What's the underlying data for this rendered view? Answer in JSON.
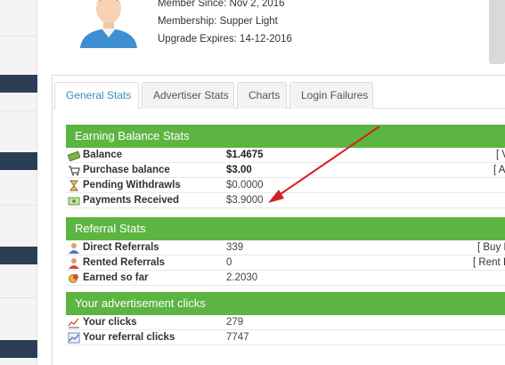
{
  "profile": {
    "member_since": "Member Since: Nov 2, 2016",
    "membership": "Membership: Supper Light",
    "upgrade_expires": "Upgrade Expires: 14-12-2016"
  },
  "tabs": [
    {
      "label": "General Stats"
    },
    {
      "label": "Advertiser Stats"
    },
    {
      "label": "Charts"
    },
    {
      "label": "Login Failures"
    }
  ],
  "earning": {
    "title": "Earning Balance Stats",
    "rows": [
      {
        "label": "Balance",
        "value": "$1.4675",
        "action": "[ V"
      },
      {
        "label": "Purchase balance",
        "value": "$3.00",
        "action": "[ A"
      },
      {
        "label": "Pending Withdrawls",
        "value": "$0.0000",
        "action": ""
      },
      {
        "label": "Payments Received",
        "value": "$3.9000",
        "action": ""
      }
    ]
  },
  "referral": {
    "title": "Referral Stats",
    "rows": [
      {
        "label": "Direct Referrals",
        "value": "339",
        "action": "[ Buy I"
      },
      {
        "label": "Rented Referrals",
        "value": "0",
        "action": "[ Rent I"
      },
      {
        "label": "Earned so far",
        "value": "2.2030",
        "action": ""
      }
    ]
  },
  "clicks": {
    "title": "Your advertisement clicks",
    "rows": [
      {
        "label": "Your clicks",
        "value": "279"
      },
      {
        "label": "Your referral clicks",
        "value": "7747"
      }
    ]
  },
  "colors": {
    "section_header": "#5cb541",
    "active_tab_text": "#3a8fbf",
    "sidebar_bar": "#2c3e55",
    "annotation_arrow": "#d42020"
  },
  "icons": {
    "balance": "money-icon",
    "purchase": "shopping-cart-icon",
    "pending": "hourglass-icon",
    "payments": "money-stack-icon",
    "direct": "user-icon",
    "rented": "user-red-icon",
    "earned": "coins-icon",
    "your_clicks": "chart-line-icon",
    "referral_clicks": "chart-icon"
  }
}
